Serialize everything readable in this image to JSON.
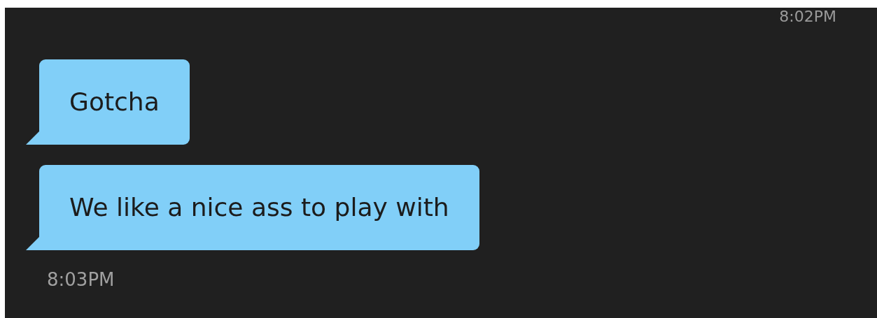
{
  "previous_timestamp": "8:02PM",
  "messages": [
    {
      "text": "Gotcha"
    },
    {
      "text": "We like a nice ass to play with"
    }
  ],
  "timestamp": "8:03PM"
}
